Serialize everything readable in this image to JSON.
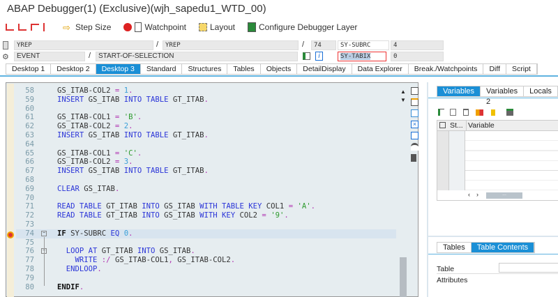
{
  "window_title": "ABAP Debugger(1)  (Exclusive)(wjh_sapedu1_WTD_00)",
  "toolbar": {
    "step_size": "Step Size",
    "watchpoint": "Watchpoint",
    "layout": "Layout",
    "configure": "Configure Debugger Layer"
  },
  "fields": {
    "program": "YREP",
    "include": "YREP",
    "line": "74",
    "sy_subrc_label": "SY-SUBRC",
    "sy_subrc_value": "4",
    "event_type": "EVENT",
    "event_name": "START-OF-SELECTION",
    "sy_tabix_label": "SY-TABIX",
    "sy_tabix_value": "0",
    "sep": "/"
  },
  "tabs": [
    "Desktop 1",
    "Desktop 2",
    "Desktop 3",
    "Standard",
    "Structures",
    "Tables",
    "Objects",
    "DetailDisplay",
    "Data Explorer",
    "Break./Watchpoints",
    "Diff",
    "Script"
  ],
  "active_tab": "Desktop 3",
  "code": [
    {
      "n": "58",
      "t": [
        [
          "id",
          "GS_ITAB-COL2 "
        ],
        [
          "op",
          "= "
        ],
        [
          "num-lit",
          "1"
        ],
        [
          "op",
          "."
        ]
      ]
    },
    {
      "n": "59",
      "t": [
        [
          "kw",
          "INSERT "
        ],
        [
          "id",
          "GS_ITAB "
        ],
        [
          "kw",
          "INTO TABLE "
        ],
        [
          "id",
          "GT_ITAB"
        ],
        [
          "op",
          "."
        ]
      ]
    },
    {
      "n": "60",
      "t": []
    },
    {
      "n": "61",
      "t": [
        [
          "id",
          "GS_ITAB-COL1 "
        ],
        [
          "op",
          "= "
        ],
        [
          "str",
          "'B'"
        ],
        [
          "op",
          "."
        ]
      ]
    },
    {
      "n": "62",
      "t": [
        [
          "id",
          "GS_ITAB-COL2 "
        ],
        [
          "op",
          "= "
        ],
        [
          "num-lit",
          "2"
        ],
        [
          "op",
          "."
        ]
      ]
    },
    {
      "n": "63",
      "t": [
        [
          "kw",
          "INSERT "
        ],
        [
          "id",
          "GS_ITAB "
        ],
        [
          "kw",
          "INTO TABLE "
        ],
        [
          "id",
          "GT_ITAB"
        ],
        [
          "op",
          "."
        ]
      ]
    },
    {
      "n": "64",
      "t": []
    },
    {
      "n": "65",
      "t": [
        [
          "id",
          "GS_ITAB-COL1 "
        ],
        [
          "op",
          "= "
        ],
        [
          "str",
          "'C'"
        ],
        [
          "op",
          "."
        ]
      ]
    },
    {
      "n": "66",
      "t": [
        [
          "id",
          "GS_ITAB-COL2 "
        ],
        [
          "op",
          "= "
        ],
        [
          "num-lit",
          "3"
        ],
        [
          "op",
          "."
        ]
      ]
    },
    {
      "n": "67",
      "t": [
        [
          "kw",
          "INSERT "
        ],
        [
          "id",
          "GS_ITAB "
        ],
        [
          "kw",
          "INTO TABLE "
        ],
        [
          "id",
          "GT_ITAB"
        ],
        [
          "op",
          "."
        ]
      ]
    },
    {
      "n": "68",
      "t": []
    },
    {
      "n": "69",
      "t": [
        [
          "kw",
          "CLEAR "
        ],
        [
          "id",
          "GS_ITAB"
        ],
        [
          "op",
          "."
        ]
      ]
    },
    {
      "n": "70",
      "t": []
    },
    {
      "n": "71",
      "t": [
        [
          "kw",
          "READ TABLE "
        ],
        [
          "id",
          "GT_ITAB "
        ],
        [
          "kw",
          "INTO "
        ],
        [
          "id",
          "GS_ITAB "
        ],
        [
          "kw",
          "WITH TABLE KEY "
        ],
        [
          "id",
          "COL1 "
        ],
        [
          "op",
          "= "
        ],
        [
          "str",
          "'A'"
        ],
        [
          "op",
          "."
        ]
      ]
    },
    {
      "n": "72",
      "t": [
        [
          "kw",
          "READ TABLE "
        ],
        [
          "id",
          "GT_ITAB "
        ],
        [
          "kw",
          "INTO "
        ],
        [
          "id",
          "GS_ITAB "
        ],
        [
          "kw",
          "WITH KEY "
        ],
        [
          "id",
          "COL2 "
        ],
        [
          "op",
          "= "
        ],
        [
          "str",
          "'9'"
        ],
        [
          "op",
          "."
        ]
      ]
    },
    {
      "n": "73",
      "t": []
    },
    {
      "n": "74",
      "t": [
        [
          "bold",
          "IF "
        ],
        [
          "id",
          "SY-SUBRC "
        ],
        [
          "kw",
          "EQ "
        ],
        [
          "num-lit",
          "0"
        ],
        [
          "op",
          "."
        ]
      ],
      "current": true
    },
    {
      "n": "75",
      "t": []
    },
    {
      "n": "76",
      "t": [
        [
          "id",
          "  "
        ],
        [
          "kw",
          "LOOP AT "
        ],
        [
          "id",
          "GT_ITAB "
        ],
        [
          "kw",
          "INTO "
        ],
        [
          "id",
          "GS_ITAB"
        ],
        [
          "op",
          "."
        ]
      ]
    },
    {
      "n": "77",
      "t": [
        [
          "id",
          "    "
        ],
        [
          "kw",
          "WRITE "
        ],
        [
          "op",
          ":/ "
        ],
        [
          "id",
          "GS_ITAB-COL1"
        ],
        [
          "op",
          ", "
        ],
        [
          "id",
          "GS_ITAB-COL2"
        ],
        [
          "op",
          "."
        ]
      ]
    },
    {
      "n": "78",
      "t": [
        [
          "id",
          "  "
        ],
        [
          "kw",
          "ENDLOOP"
        ],
        [
          "op",
          "."
        ]
      ]
    },
    {
      "n": "79",
      "t": []
    },
    {
      "n": "80",
      "t": [
        [
          "bold",
          "ENDIF"
        ],
        [
          "op",
          "."
        ]
      ]
    }
  ],
  "right_panel": {
    "tabs": [
      "Variables 1",
      "Variables 2",
      "Locals"
    ],
    "grid_headers": [
      "St...",
      "Variable"
    ],
    "bottom_tabs": [
      "Tables",
      "Table Contents"
    ],
    "table_label": "Table",
    "attributes_label": "Attributes",
    "hscroll_thumb": "..."
  }
}
